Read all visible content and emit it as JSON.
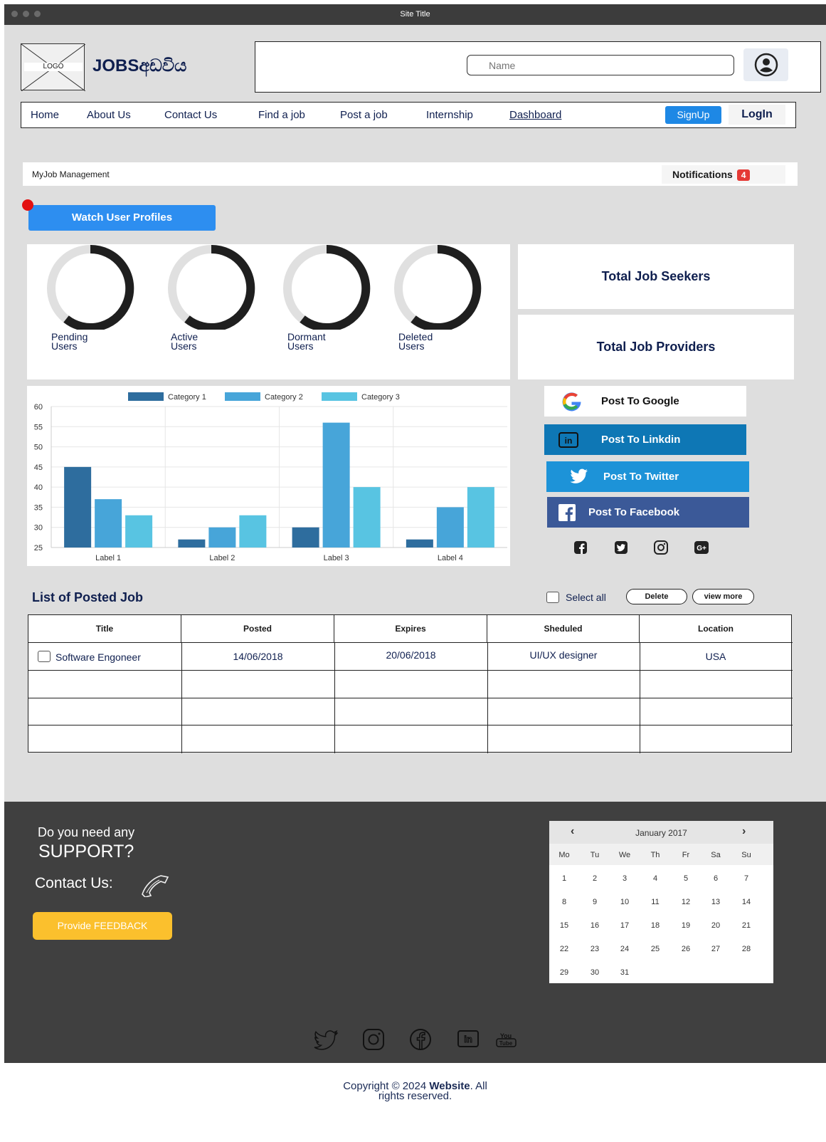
{
  "window": {
    "title": "Site Title"
  },
  "header": {
    "logo_label": "LOGO",
    "brand": "JOBSඅඩවිය",
    "search_placeholder": "Name"
  },
  "nav": {
    "items": [
      "Home",
      "About Us",
      "Contact Us",
      "Find a job",
      "Post a job",
      "Internship",
      "Dashboard"
    ],
    "signup": "SignUp",
    "login": "LogIn"
  },
  "subheader": {
    "title": "MyJob Management",
    "notifications_label": "Notifications",
    "notifications_count": "4"
  },
  "watch_button": "Watch User Profiles",
  "user_stats": [
    {
      "label1": "Pending",
      "label2": "Users"
    },
    {
      "label1": "Active",
      "label2": "Users"
    },
    {
      "label1": "Dormant",
      "label2": "Users"
    },
    {
      "label1": "Deleted",
      "label2": "Users"
    }
  ],
  "totals": {
    "seekers": "Total Job Seekers",
    "providers": "Total Job Providers"
  },
  "chart_data": {
    "type": "bar",
    "categories": [
      "Label 1",
      "Label 2",
      "Label 3",
      "Label 4"
    ],
    "series": [
      {
        "name": "Category 1",
        "values": [
          45,
          27,
          30,
          27
        ],
        "color": "#2e6d9e"
      },
      {
        "name": "Category 2",
        "values": [
          37,
          30,
          56,
          35
        ],
        "color": "#47a5d9"
      },
      {
        "name": "Category 3",
        "values": [
          33,
          33,
          40,
          40
        ],
        "color": "#58c4e2"
      }
    ],
    "yticks": [
      25,
      30,
      35,
      40,
      45,
      50,
      55,
      60
    ],
    "ylim": [
      25,
      60
    ],
    "legend": "top",
    "grid": true
  },
  "share": {
    "google": "Post To Google",
    "linkedin": "Post To Linkdin",
    "twitter": "Post To Twitter",
    "facebook": "Post To Facebook"
  },
  "jobs": {
    "title": "List of Posted Job",
    "select_all": "Select all",
    "delete": "Delete",
    "view_more": "view more",
    "columns": [
      "Title",
      "Posted",
      "Expires",
      "Sheduled",
      "Location"
    ],
    "rows": [
      {
        "title": "Software Engoneer",
        "posted": "14/06/2018",
        "expires": "20/06/2018",
        "scheduled": "UI/UX designer",
        "location": "USA"
      }
    ]
  },
  "footer": {
    "line1": "Do you need any",
    "line2": "SUPPORT?",
    "contact": "Contact Us:",
    "feedback": "Provide FEEDBACK",
    "calendar": {
      "month": "January 2017",
      "weekdays": [
        "Mo",
        "Tu",
        "We",
        "Th",
        "Fr",
        "Sa",
        "Su"
      ],
      "weeks": [
        [
          "1",
          "2",
          "3",
          "4",
          "5",
          "6",
          "7"
        ],
        [
          "8",
          "9",
          "10",
          "11",
          "12",
          "13",
          "14"
        ],
        [
          "15",
          "16",
          "17",
          "18",
          "19",
          "20",
          "21"
        ],
        [
          "22",
          "23",
          "24",
          "25",
          "26",
          "27",
          "28"
        ],
        [
          "29",
          "30",
          "31",
          "",
          "",
          "",
          ""
        ]
      ]
    },
    "copyright_pre": "Copyright © 2024 ",
    "copyright_site": "Website",
    "copyright_post": ". All",
    "copyright_line2": "rights reserved."
  },
  "colors": {
    "accent_blue": "#2d8ef0",
    "badge_red": "#e53935",
    "feedback_yellow": "#fbc02d",
    "linkedin": "#0e77b5",
    "twitter": "#1d93d8",
    "facebook": "#3b5998"
  }
}
